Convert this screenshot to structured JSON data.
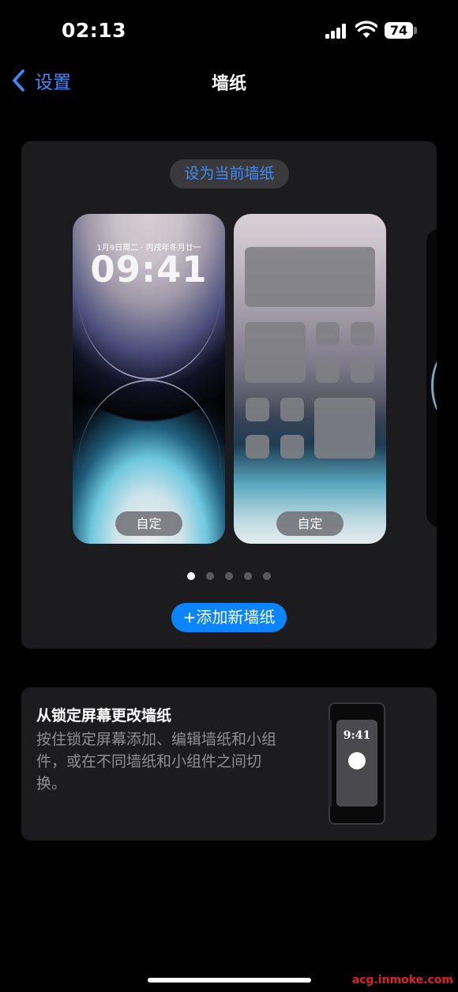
{
  "status_bar": {
    "time": "02:13",
    "battery": "74"
  },
  "nav": {
    "back_label": "设置",
    "title": "墙纸"
  },
  "wallpaper_card": {
    "set_current_label": "设为当前墙纸",
    "lock_preview": {
      "date": "1月9日周二 · 丙戌年冬月廿一",
      "time": "09:41",
      "customize_label": "自定"
    },
    "home_preview": {
      "customize_label": "自定"
    },
    "page_count": 5,
    "active_page": 1,
    "add_label": "+添加新墙纸"
  },
  "info_card": {
    "title": "从锁定屏幕更改墙纸",
    "body": "按住锁定屏幕添加、编辑墙纸和小组件，或在不同墙纸和小组件之间切换。",
    "illustration_time": "9:41"
  },
  "watermark": "acg.inmoke.com",
  "colors": {
    "accent": "#0a84ff",
    "link": "#3a8bff",
    "card": "#1c1c1e"
  }
}
